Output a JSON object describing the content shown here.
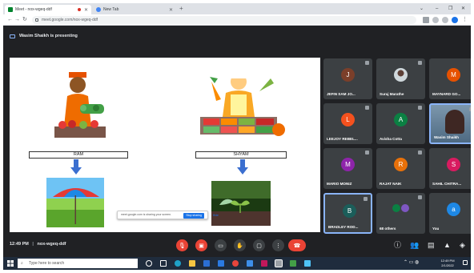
{
  "browser": {
    "tabs": [
      {
        "title": "Meet - nox-wgeq-ddf",
        "active": true
      },
      {
        "title": "New Tab",
        "active": false
      }
    ],
    "url": "meet.google.com/nox-wgeq-ddf"
  },
  "meet": {
    "presenting_text": "Wasim Shaikh is presenting",
    "time": "12:49 PM",
    "meeting_code": "nox-wgeq-ddf",
    "separator": "|"
  },
  "slide": {
    "left_name": "RAM",
    "right_name": "SHYAM"
  },
  "share_bar": {
    "message": "meet.google.com is sharing your screen.",
    "stop_label": "Stop sharing",
    "hide_label": "Hide"
  },
  "participants": [
    {
      "name": "JEFIN SAM JO...",
      "initial": "J",
      "color": "#7b3f2a",
      "type": "avatar"
    },
    {
      "name": "Suraj Marathe",
      "initial": "",
      "color": "#cfd8dc",
      "type": "photo"
    },
    {
      "name": "MAYNARD GO...",
      "initial": "M",
      "color": "#e65100",
      "type": "avatar"
    },
    {
      "name": "LEEJOY REBEL...",
      "initial": "L",
      "color": "#f4511e",
      "type": "avatar"
    },
    {
      "name": "Avisha Cotta",
      "initial": "A",
      "color": "#0b8043",
      "type": "avatar"
    },
    {
      "name": "Wasim Shaikh",
      "initial": "",
      "color": "#6d8fa8",
      "type": "video"
    },
    {
      "name": "MARIO MONIZ",
      "initial": "M",
      "color": "#8e24aa",
      "type": "avatar"
    },
    {
      "name": "RAJAT NAIK",
      "initial": "R",
      "color": "#e8710a",
      "type": "avatar"
    },
    {
      "name": "SAHIL CHITRA...",
      "initial": "S",
      "color": "#d81b60",
      "type": "avatar"
    },
    {
      "name": "BRADLEY ROD...",
      "initial": "B",
      "color": "#1b5e5a",
      "type": "avatar"
    },
    {
      "name": "68 others",
      "initial": "",
      "color": "#3c4043",
      "type": "others"
    },
    {
      "name": "You",
      "initial": "a",
      "color": "#1e88e5",
      "type": "avatar"
    }
  ],
  "taskbar": {
    "search_placeholder": "Type here to search",
    "clock_time": "12:49 PM",
    "clock_date": "2/1/2022"
  },
  "colors": {
    "meet_bg": "#202124",
    "tile_bg": "#3c4043",
    "red_button": "#ea4335",
    "accent_blue": "#8ab4f8"
  }
}
